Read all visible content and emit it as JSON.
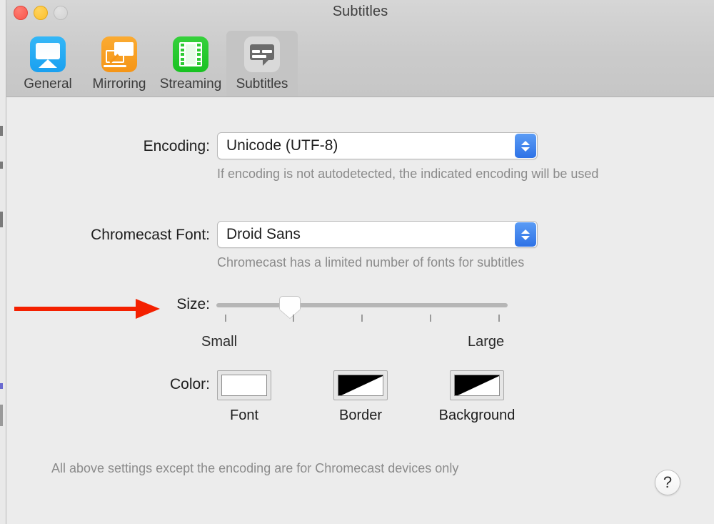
{
  "window": {
    "title": "Subtitles",
    "traffic_lights": [
      {
        "name": "close",
        "color": "#f9564b"
      },
      {
        "name": "minimize",
        "color": "#fcc02e"
      },
      {
        "name": "zoom",
        "color": "#d2d2d2"
      }
    ]
  },
  "toolbar": {
    "tabs": [
      {
        "label": "General",
        "icon": "airplay-icon",
        "selected": false
      },
      {
        "label": "Mirroring",
        "icon": "mirroring-icon",
        "selected": false
      },
      {
        "label": "Streaming",
        "icon": "filmstrip-icon",
        "selected": false
      },
      {
        "label": "Subtitles",
        "icon": "subtitles-icon",
        "selected": true
      }
    ]
  },
  "main": {
    "encoding": {
      "label": "Encoding:",
      "value": "Unicode (UTF-8)",
      "hint": "If encoding is not autodetected, the indicated encoding will be used"
    },
    "chromecast_font": {
      "label": "Chromecast Font:",
      "value": "Droid Sans",
      "hint": "Chromecast has a limited number of fonts for subtitles"
    },
    "size": {
      "label": "Size:",
      "min_label": "Small",
      "max_label": "Large",
      "tick_count": 5,
      "value_percent": 23
    },
    "color": {
      "label": "Color:",
      "wells": [
        {
          "caption": "Font",
          "swatch": "solid-white"
        },
        {
          "caption": "Border",
          "swatch": "black-white-diagonal"
        },
        {
          "caption": "Background",
          "swatch": "black-white-diagonal"
        }
      ]
    },
    "footer_note": "All above settings except the encoding are for Chromecast devices only",
    "help_glyph": "?"
  },
  "annotation": {
    "arrow_color": "#f42000",
    "points_to": "Size:"
  }
}
